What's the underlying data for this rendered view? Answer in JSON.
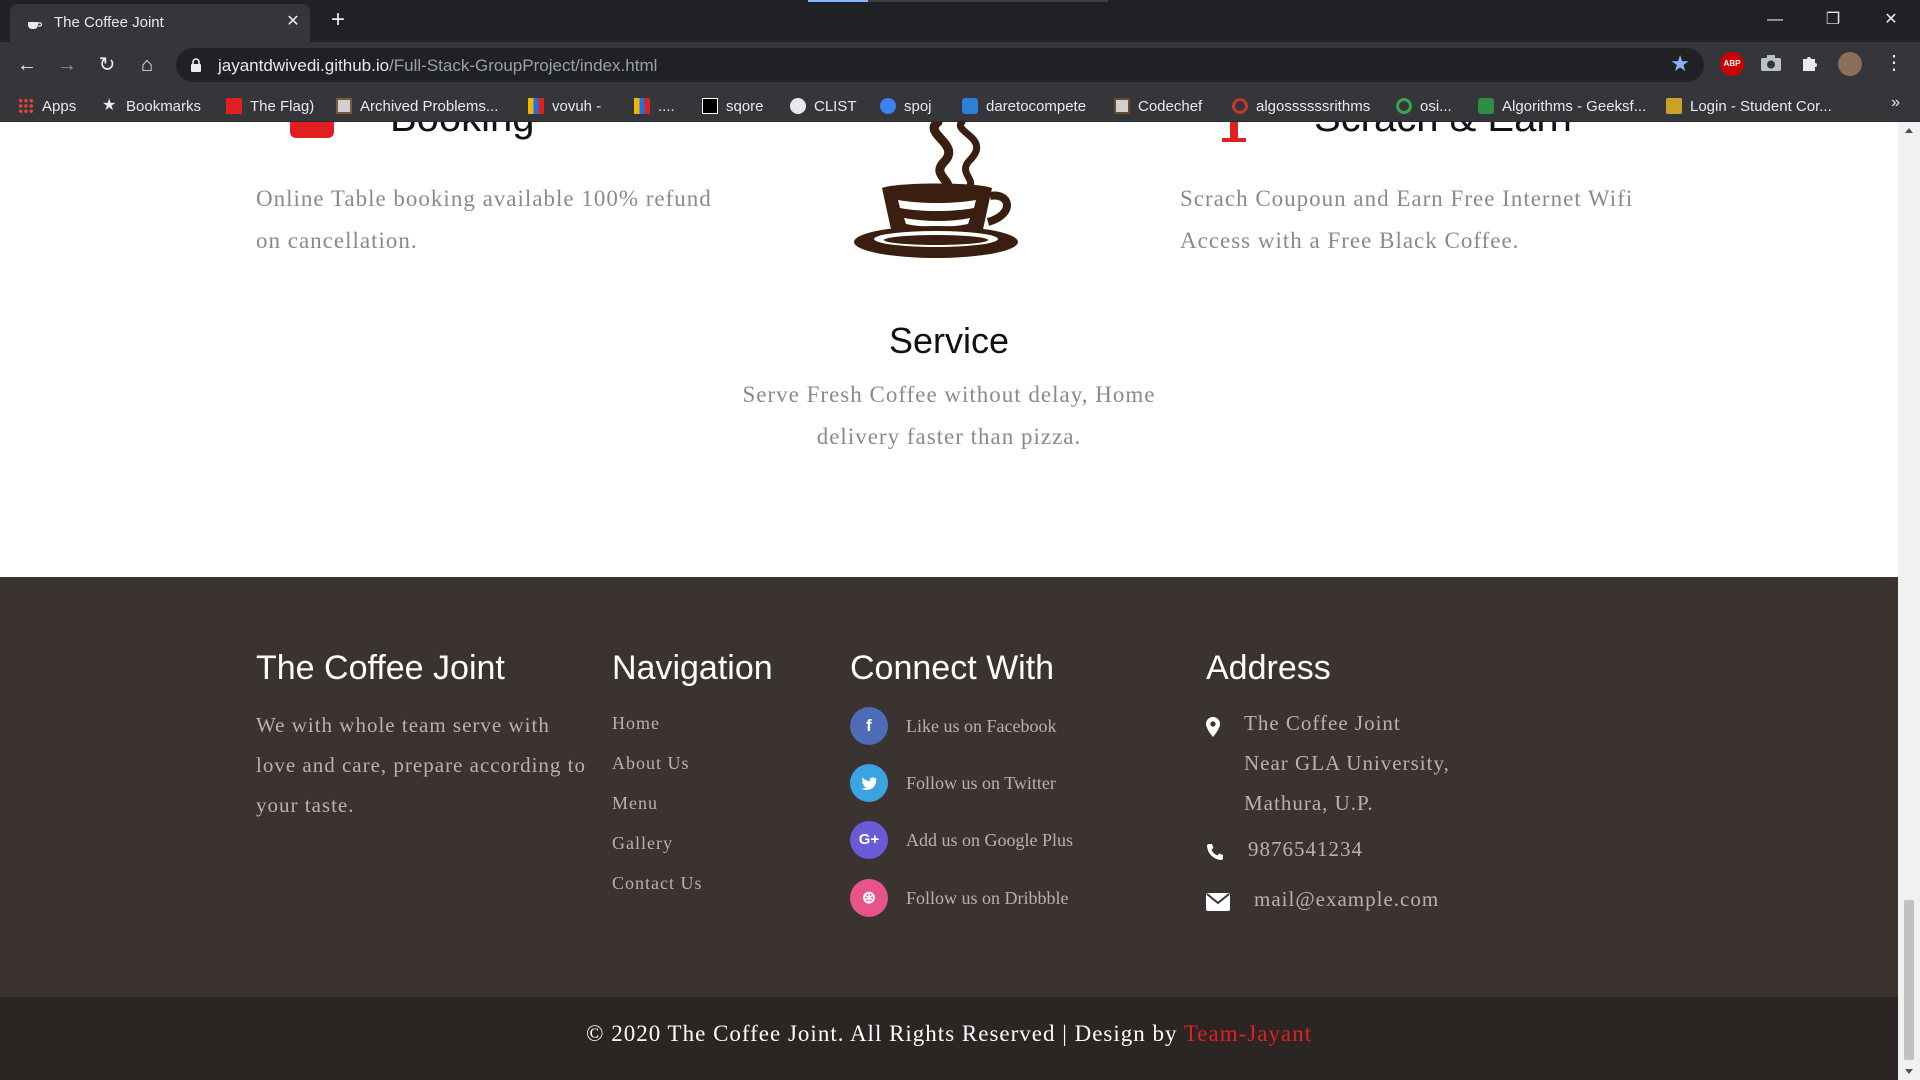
{
  "browser": {
    "tab_title": "The Coffee Joint",
    "url_host": "jayantdwivedi.github.io",
    "url_path": "/Full-Stack-GroupProject/index.html",
    "bookmarks": [
      {
        "label": "Apps",
        "icon": "apps-grid-icon",
        "color": "#4285f4"
      },
      {
        "label": "Bookmarks",
        "icon": "star-icon",
        "color": "#e8eaed"
      },
      {
        "label": "The Flag)",
        "icon": "flag-icon",
        "color": "#e02020"
      },
      {
        "label": "Archived Problems...",
        "icon": "archive-icon",
        "color": "#d0d0d0"
      },
      {
        "label": "vovuh -",
        "icon": "codeforces-icon",
        "color": "#f5b400"
      },
      {
        "label": "....",
        "icon": "codeforces-icon",
        "color": "#f5b400"
      },
      {
        "label": "sqore",
        "icon": "sqore-icon",
        "color": "#000000"
      },
      {
        "label": "CLIST",
        "icon": "globe-icon",
        "color": "#e8eaed"
      },
      {
        "label": "spoj",
        "icon": "spoj-icon",
        "color": "#3b82f6"
      },
      {
        "label": "daretocompete",
        "icon": "puzzle-icon",
        "color": "#2f7fd8"
      },
      {
        "label": "Codechef",
        "icon": "codechef-icon",
        "color": "#d0d0d0"
      },
      {
        "label": "algossssssrithms",
        "icon": "search-icon",
        "color": "#c0392b"
      },
      {
        "label": "osi...",
        "icon": "github-icon",
        "color": "#3fa34d"
      },
      {
        "label": "Algorithms - Geeksf...",
        "icon": "geeks-icon",
        "color": "#2f8d46"
      },
      {
        "label": "Login - Student Cor...",
        "icon": "login-icon",
        "color": "#c9a227"
      }
    ]
  },
  "features": {
    "booking_title": "Booking",
    "booking_desc": "Online Table booking available 100% refund on cancellation.",
    "scratch_title": "Scrach & Earn",
    "scratch_desc": "Scrach Coupoun and Earn Free Internet Wifi Access with a Free Black Coffee.",
    "service_title": "Service",
    "service_desc": "Serve Fresh Coffee without delay, Home delivery faster than pizza."
  },
  "footer": {
    "about": {
      "heading": "The Coffee Joint",
      "text": "We with whole team serve with love and care, prepare according to your taste."
    },
    "navigation": {
      "heading": "Navigation",
      "links": [
        "Home",
        "About Us",
        "Menu",
        "Gallery",
        "Contact Us"
      ]
    },
    "connect": {
      "heading": "Connect With",
      "items": [
        {
          "label": "Like us on Facebook",
          "icon": "facebook-icon",
          "color": "#4e6bb5",
          "glyph": "f"
        },
        {
          "label": "Follow us on Twitter",
          "icon": "twitter-icon",
          "color": "#3aa3e0",
          "glyph": "t"
        },
        {
          "label": "Add us on Google Plus",
          "icon": "google-plus-icon",
          "color": "#6a5ad8",
          "glyph": "G+"
        },
        {
          "label": "Follow us on Dribbble",
          "icon": "dribbble-icon",
          "color": "#e8538a",
          "glyph": "⊛"
        }
      ]
    },
    "address": {
      "heading": "Address",
      "line1": "The Coffee Joint",
      "line2": "Near GLA University,",
      "line3": "Mathura, U.P.",
      "phone": "9876541234",
      "email": "mail@example.com"
    }
  },
  "copyright": {
    "text": "© 2020 The Coffee Joint. All Rights Reserved | Design by ",
    "credit": "Team-Jayant"
  },
  "colors": {
    "accent": "#e02020",
    "footer_bg": "#3b3330",
    "copyright_bg": "#2b2523"
  }
}
